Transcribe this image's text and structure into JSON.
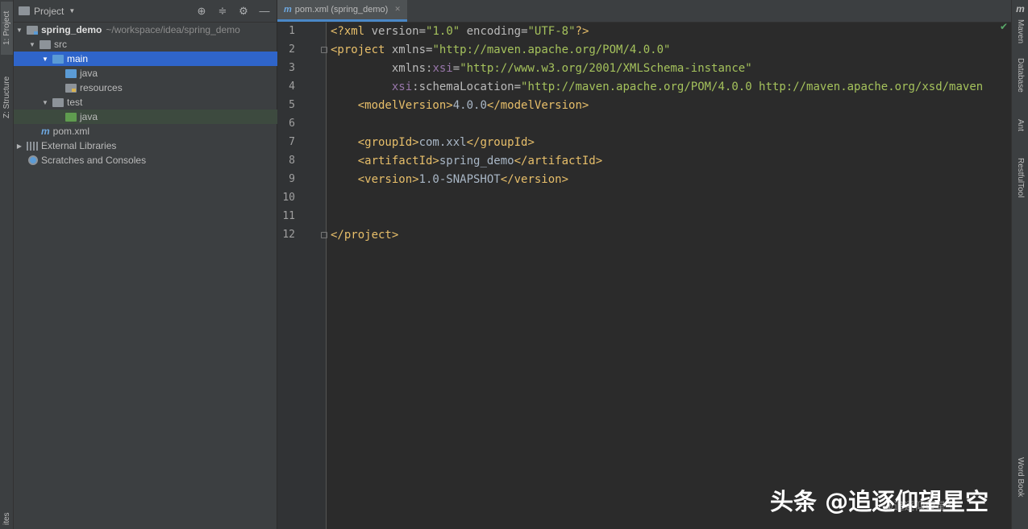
{
  "left_strip": {
    "project_tab": "1: Project",
    "structure_tab": "Z: Structure",
    "favorites_tab": "ites"
  },
  "right_strip": {
    "maven": "Maven",
    "database": "Database",
    "ant": "Ant",
    "restful": "RestfulTool",
    "wordbook": "Word Book",
    "maven_icon": "m"
  },
  "project_panel": {
    "title": "Project",
    "tree": [
      {
        "label": "spring_demo",
        "path": "~/workspace/idea/spring_demo"
      },
      {
        "label": "src"
      },
      {
        "label": "main"
      },
      {
        "label": "java"
      },
      {
        "label": "resources"
      },
      {
        "label": "test"
      },
      {
        "label": "java"
      },
      {
        "label": "pom.xml",
        "icon": "m"
      },
      {
        "label": "External Libraries"
      },
      {
        "label": "Scratches and Consoles"
      }
    ]
  },
  "editor": {
    "tab_label": "pom.xml (spring_demo)",
    "tab_icon": "m",
    "line_numbers": [
      "1",
      "2",
      "3",
      "4",
      "5",
      "6",
      "7",
      "8",
      "9",
      "10",
      "11",
      "12"
    ]
  },
  "code": {
    "l1": {
      "open": "<?xml ",
      "a1": "version",
      "eq1": "=",
      "v1": "\"1.0\"",
      "sp": " ",
      "a2": "encoding",
      "eq2": "=",
      "v2": "\"UTF-8\"",
      "close": "?>"
    },
    "l2": {
      "open": "<project ",
      "a1": "xmlns",
      "eq": "=",
      "v1": "\"http://maven.apache.org/POM/4.0.0\""
    },
    "l3": {
      "indent": "         ",
      "a1": "xmlns",
      "colon": ":",
      "ns": "xsi",
      "eq": "=",
      "v1": "\"http://www.w3.org/2001/XMLSchema-instance\""
    },
    "l4": {
      "indent": "         ",
      "ns": "xsi",
      "colon": ":",
      "a1": "schemaLocation",
      "eq": "=",
      "v1": "\"http://maven.apache.org/POM/4.0.0 http://maven.apache.org/xsd/maven"
    },
    "l5": {
      "indent": "    ",
      "o": "<modelVersion>",
      "text": "4.0.0",
      "c": "</modelVersion>"
    },
    "l7": {
      "indent": "    ",
      "o": "<groupId>",
      "text": "com.xxl",
      "c": "</groupId>"
    },
    "l8": {
      "indent": "    ",
      "o": "<artifactId>",
      "text": "spring_demo",
      "c": "</artifactId>"
    },
    "l9": {
      "indent": "    ",
      "o": "<version>",
      "text": "1.0-SNAPSHOT",
      "c": "</version>"
    },
    "l12": {
      "c": "</project>"
    }
  },
  "watermark": {
    "main": "头条 @追逐仰望星空",
    "sub": "@追逐仰望星空"
  },
  "colors": {
    "selection": "#2f65ca",
    "editor_bg": "#2b2b2b",
    "panel_bg": "#3c3f41",
    "tag": "#e8bf6a",
    "string": "#a5c25c",
    "namespace": "#9876aa"
  }
}
